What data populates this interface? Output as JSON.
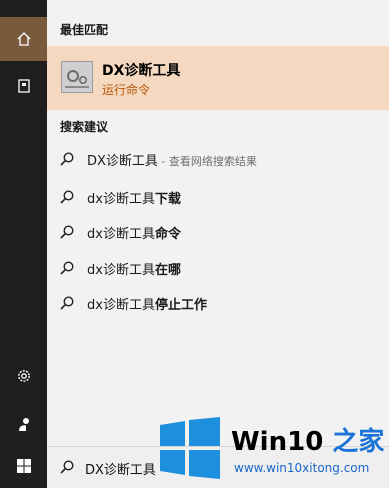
{
  "sidebar": {
    "items": [
      {
        "icon": "home-icon"
      },
      {
        "icon": "document-icon"
      },
      {
        "icon": "gear-icon"
      },
      {
        "icon": "person-icon"
      },
      {
        "icon": "windows-start-icon"
      }
    ],
    "active_color": "#7a5a3c"
  },
  "best_match": {
    "header": "最佳匹配",
    "title": "DX诊断工具",
    "subtitle": "运行命令",
    "icon": "dxdiag-app-icon",
    "highlight_color": "#f4d9c0"
  },
  "suggestions": {
    "header": "搜索建议",
    "items": [
      {
        "prefix": "DX诊断工具",
        "bold": "",
        "suffix": " - 查看网络搜索结果"
      },
      {
        "prefix": "dx诊断工具",
        "bold": "下载",
        "suffix": ""
      },
      {
        "prefix": "dx诊断工具",
        "bold": "命令",
        "suffix": ""
      },
      {
        "prefix": "dx诊断工具",
        "bold": "在哪",
        "suffix": ""
      },
      {
        "prefix": "dx诊断工具",
        "bold": "停止工作",
        "suffix": ""
      }
    ]
  },
  "search": {
    "value": "DX诊断工具"
  },
  "watermark": {
    "brand_a": "Win10",
    "brand_b": " 之家",
    "url": "www.win10xitong.com"
  }
}
